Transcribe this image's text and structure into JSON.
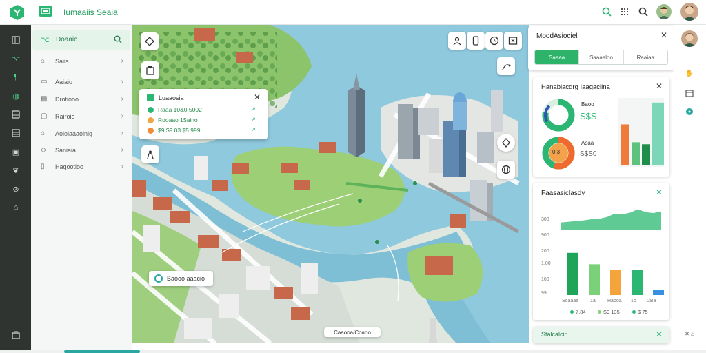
{
  "app": {
    "title": "Iumaaiis Seaia"
  },
  "topbar": {
    "icons": [
      "search-icon",
      "grid-icon",
      "search-icon",
      "user-avatar",
      "user-avatar"
    ]
  },
  "sidebar": {
    "header": "Doaaic",
    "items": [
      {
        "label": "Saiis",
        "icon": "home-icon"
      },
      {
        "label": "Aaiaio",
        "icon": "layers-icon"
      },
      {
        "label": "Drotiooo",
        "icon": "building-icon"
      },
      {
        "label": "Rairoio",
        "icon": "document-icon"
      },
      {
        "label": "Aoiolaaaoinig",
        "icon": "flag-icon"
      },
      {
        "label": "Saniaia",
        "icon": "tag-icon"
      },
      {
        "label": "Haqootioo",
        "icon": "file-icon"
      }
    ]
  },
  "map": {
    "popup": {
      "title": "Luaaosia",
      "rows": [
        {
          "text": "Raaa 10&0 5002",
          "color": "#2bb673",
          "end": "↗"
        },
        {
          "text": "Rooaao 1$aino",
          "color": "#f2a541",
          "end": "↗"
        },
        {
          "text": "$9 $9 03 $5 999",
          "color": "#f28c38",
          "end": "↗"
        }
      ]
    },
    "bottom_pill": "Baooo aaacio",
    "footer_label": "Caaooa/Coaoo"
  },
  "panel_mode": {
    "title": "MoodAsiociel",
    "tabs": [
      "Saaaa",
      "Saaaaloo",
      "Raaiaa"
    ],
    "active_tab": 0
  },
  "panel_stats": {
    "title": "Hanablacdrg Iaagaclina",
    "donut1": {
      "label": "Baoo",
      "value": "S$S",
      "pct": 0.78
    },
    "donut2": {
      "label": "Asaa",
      "value": "S$S0",
      "center": "0.3",
      "pct": 0.55
    },
    "bars": [
      {
        "value": 0.62,
        "color": "#f07a3a"
      },
      {
        "value": 0.35,
        "color": "#5cc27d"
      },
      {
        "value": 0.32,
        "color": "#1e8f4a"
      },
      {
        "value": 0.95,
        "color": "#7ed6b8"
      }
    ]
  },
  "panel_chart": {
    "title": "Faasasiclasdy",
    "y_ticks": [
      "300",
      "900",
      "200",
      "1.00",
      "100",
      "99"
    ],
    "x_ticks": [
      "Soaaaa",
      "1ai",
      "Haooa",
      "1o",
      "2Ba"
    ],
    "legend": [
      {
        "text": "7.84",
        "color": "#2bb673"
      },
      {
        "text": "S9 135",
        "color": "#8bd17c"
      },
      {
        "text": "$ 75",
        "color": "#2bb673"
      }
    ],
    "chart_data": {
      "type": "bar",
      "categories": [
        "Soaaaa",
        "1ai",
        "Haooa",
        "1o",
        "2Ba"
      ],
      "values": [
        0.85,
        0.62,
        0.5,
        0.5,
        0.1
      ],
      "colors": [
        "#1fa55a",
        "#7bd17a",
        "#f4a43a",
        "#2bb673",
        "#3a8fe0"
      ],
      "area": [
        0.35,
        0.38,
        0.42,
        0.45,
        0.5,
        0.52,
        0.6,
        0.75,
        0.72,
        0.8,
        0.95,
        0.82,
        0.78,
        0.85
      ]
    }
  },
  "panel_footer": {
    "title": "Stalcalcin"
  }
}
